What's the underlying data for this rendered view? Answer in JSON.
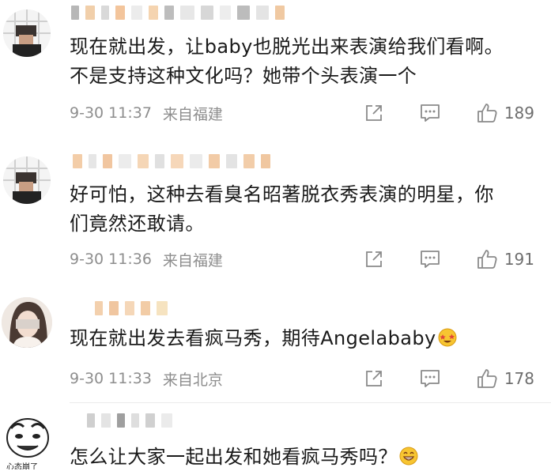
{
  "comments": [
    {
      "text": "现在就出发，让baby也脱光出来表演给我们看啊。\n不是支持这种文化吗？她带个头表演一个",
      "time": "9-30 11:37",
      "location": "来自福建",
      "likes": "189",
      "avatar_icon": "user-avatar-pixelated",
      "emoji_icon": ""
    },
    {
      "text": "好可怕，这种去看臭名昭著脱衣秀表演的明星，你\n们竟然还敢请。",
      "time": "9-30 11:36",
      "location": "来自福建",
      "likes": "191",
      "avatar_icon": "user-avatar-pixelated",
      "emoji_icon": ""
    },
    {
      "text": "现在就出发去看疯马秀，期待Angelababy",
      "time": "9-30 11:33",
      "location": "来自北京",
      "likes": "178",
      "avatar_icon": "user-avatar-photo",
      "emoji_icon": "starstruck-emoji"
    },
    {
      "text": "怎么让大家一起出发和她看疯马秀吗？",
      "time": "",
      "location": "",
      "likes": "",
      "avatar_icon": "meme-avatar",
      "avatar_caption": "心态崩了",
      "emoji_icon": "grin-emoji"
    }
  ],
  "colors": {
    "meta_gray": "#8e8e8e",
    "icon_gray": "#8a8a8a",
    "text": "#1a1a1a",
    "mosaic_orange": "#f2c9a3",
    "mosaic_gray": "#b8b8b8"
  }
}
